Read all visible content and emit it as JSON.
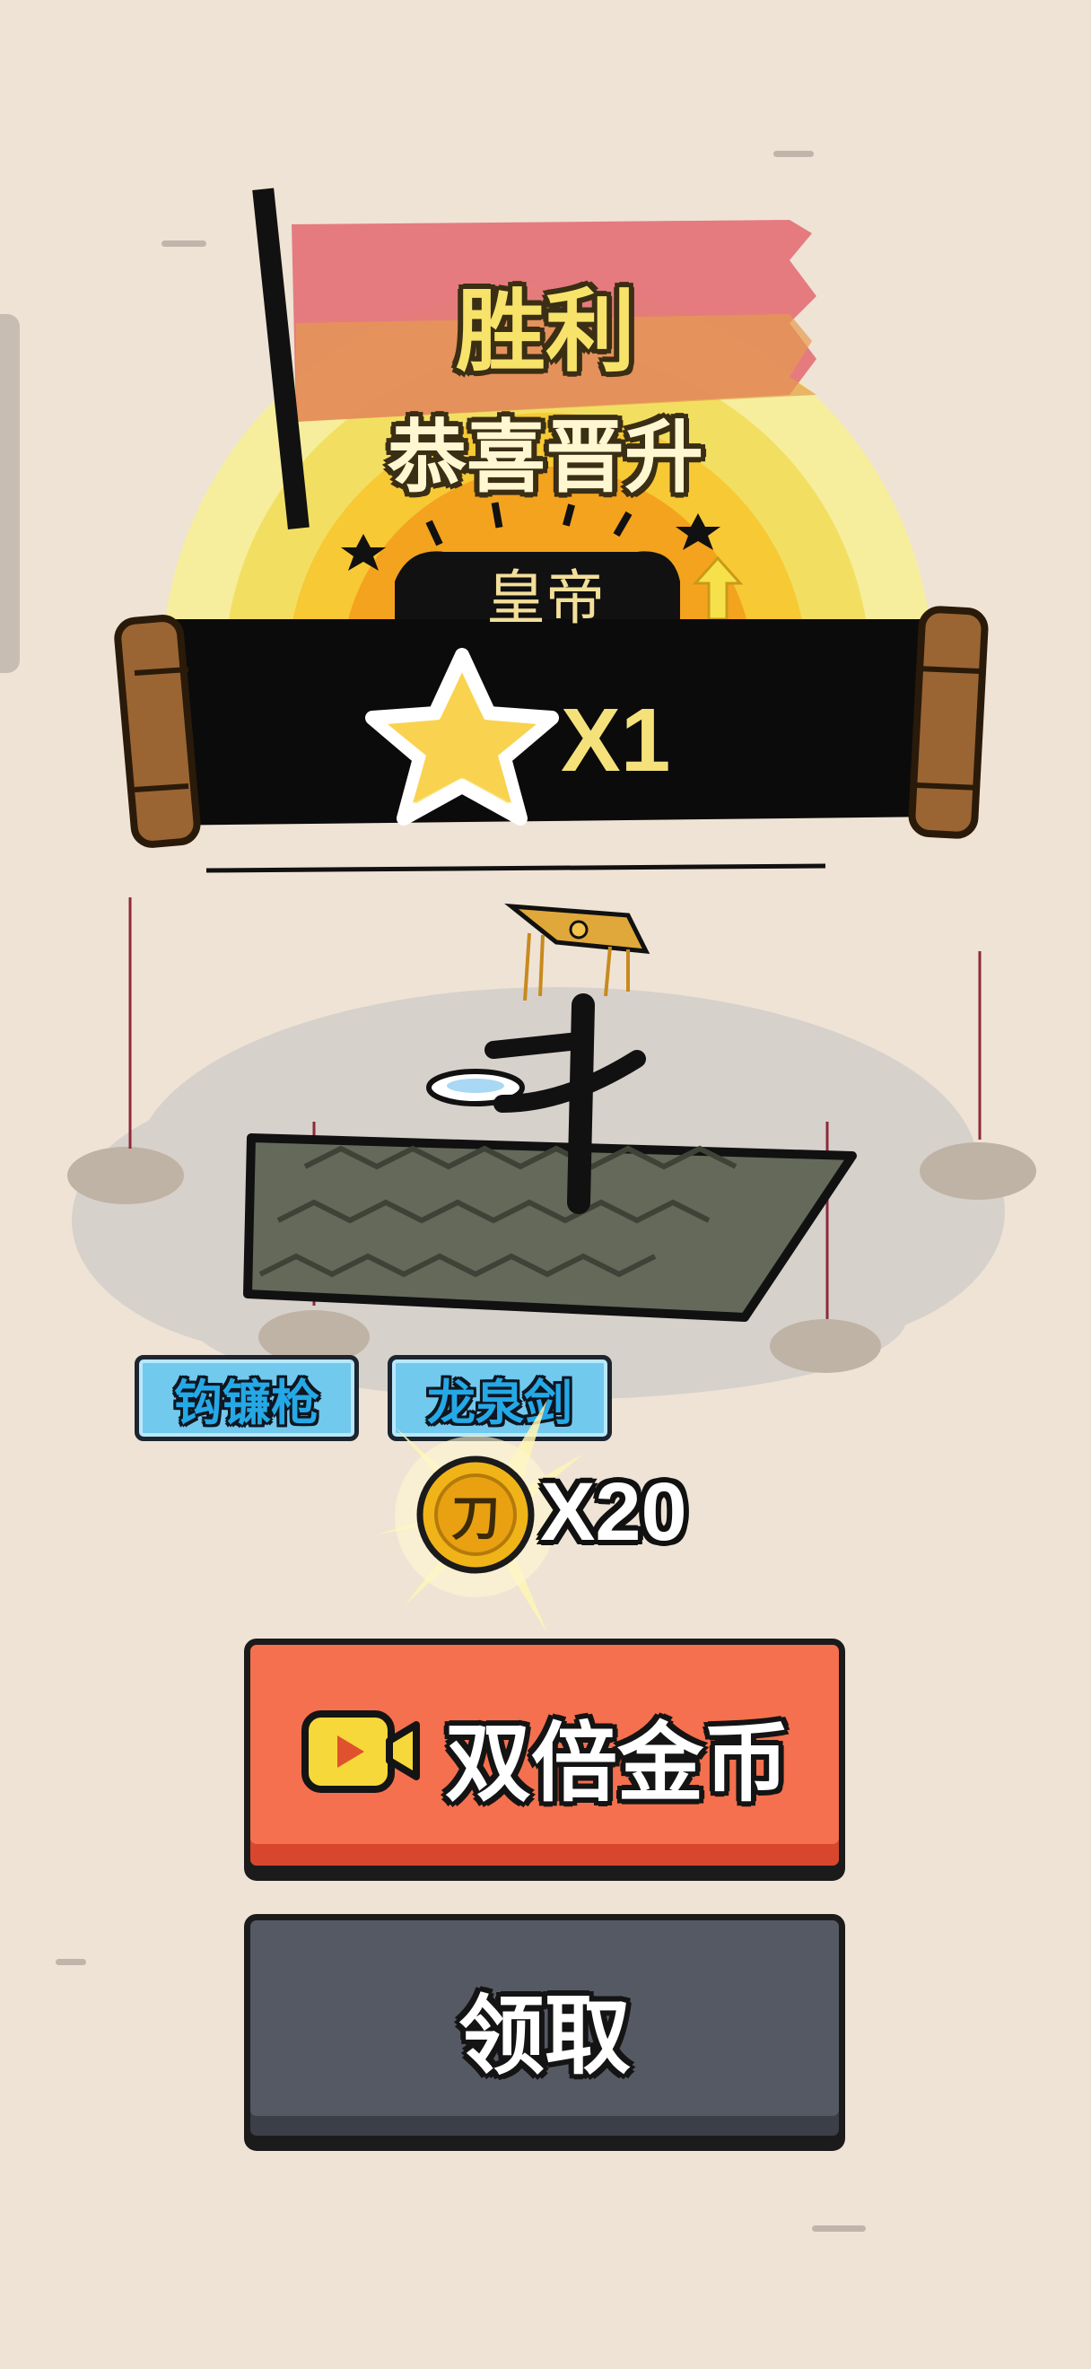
{
  "header": {
    "victory_title": "胜利",
    "congrats_text": "恭喜晋升",
    "rank_name": "皇帝",
    "star_multiplier": "X1"
  },
  "weapon_tags": [
    "钩镰枪",
    "龙泉剑"
  ],
  "reward": {
    "coin_icon_glyph": "刀",
    "amount_text": "X20"
  },
  "buttons": {
    "double_coins_label": "双倍金币",
    "claim_label": "领取"
  },
  "colors": {
    "background": "#efe3d6",
    "flag_red": "#e4757a",
    "sun_yellow": "#f6d64b",
    "double_button": "#f5704e",
    "claim_button": "#555963",
    "tag_blue": "#72c9ee",
    "coin_gold": "#f0b419"
  },
  "icons": {
    "video": "video-camera-icon",
    "star": "star-icon",
    "coin": "coin-icon",
    "flag": "flag-icon"
  }
}
